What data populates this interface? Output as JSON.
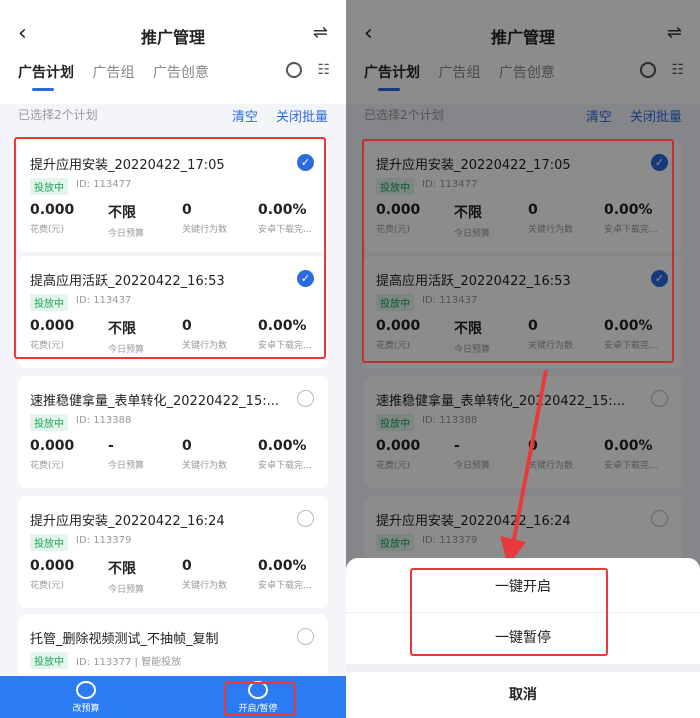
{
  "header": {
    "title": "推广管理"
  },
  "tabs": [
    "广告计划",
    "广告组",
    "广告创意"
  ],
  "selection": {
    "text": "已选择2个计划",
    "clear": "清空",
    "batch_close": "关闭批量"
  },
  "stat_labels": [
    "花费(元)",
    "今日预算",
    "关键行为数",
    "安卓下载完..."
  ],
  "cards": [
    {
      "name": "提升应用安装_20220422_17:05",
      "status": "投放中",
      "id": "ID: 113477",
      "values": [
        "0.000",
        "不限",
        "0",
        "0.00%"
      ]
    },
    {
      "name": "提高应用活跃_20220422_16:53",
      "status": "投放中",
      "id": "ID: 113437",
      "values": [
        "0.000",
        "不限",
        "0",
        "0.00%"
      ]
    },
    {
      "name": "速推稳健拿量_表单转化_20220422_15:...",
      "status": "投放中",
      "id": "ID: 113388",
      "values": [
        "0.000",
        "-",
        "0",
        "0.00%"
      ]
    },
    {
      "name": "提升应用安装_20220422_16:24",
      "status": "投放中",
      "id": "ID: 113379",
      "values": [
        "0.000",
        "不限",
        "0",
        "0.00%"
      ]
    },
    {
      "name": "托管_删除视频测试_不抽帧_复制",
      "status": "投放中",
      "id": "ID: 113377 | 智能投放",
      "values": []
    }
  ],
  "bottom": {
    "budget": "改预算",
    "toggle": "开启/暂停"
  },
  "sheet": {
    "open": "一键开启",
    "pause": "一键暂停",
    "cancel": "取消"
  },
  "colors": {
    "accent": "#2b6be0",
    "highlight": "#e83a3a",
    "status": "#1aa35a"
  }
}
